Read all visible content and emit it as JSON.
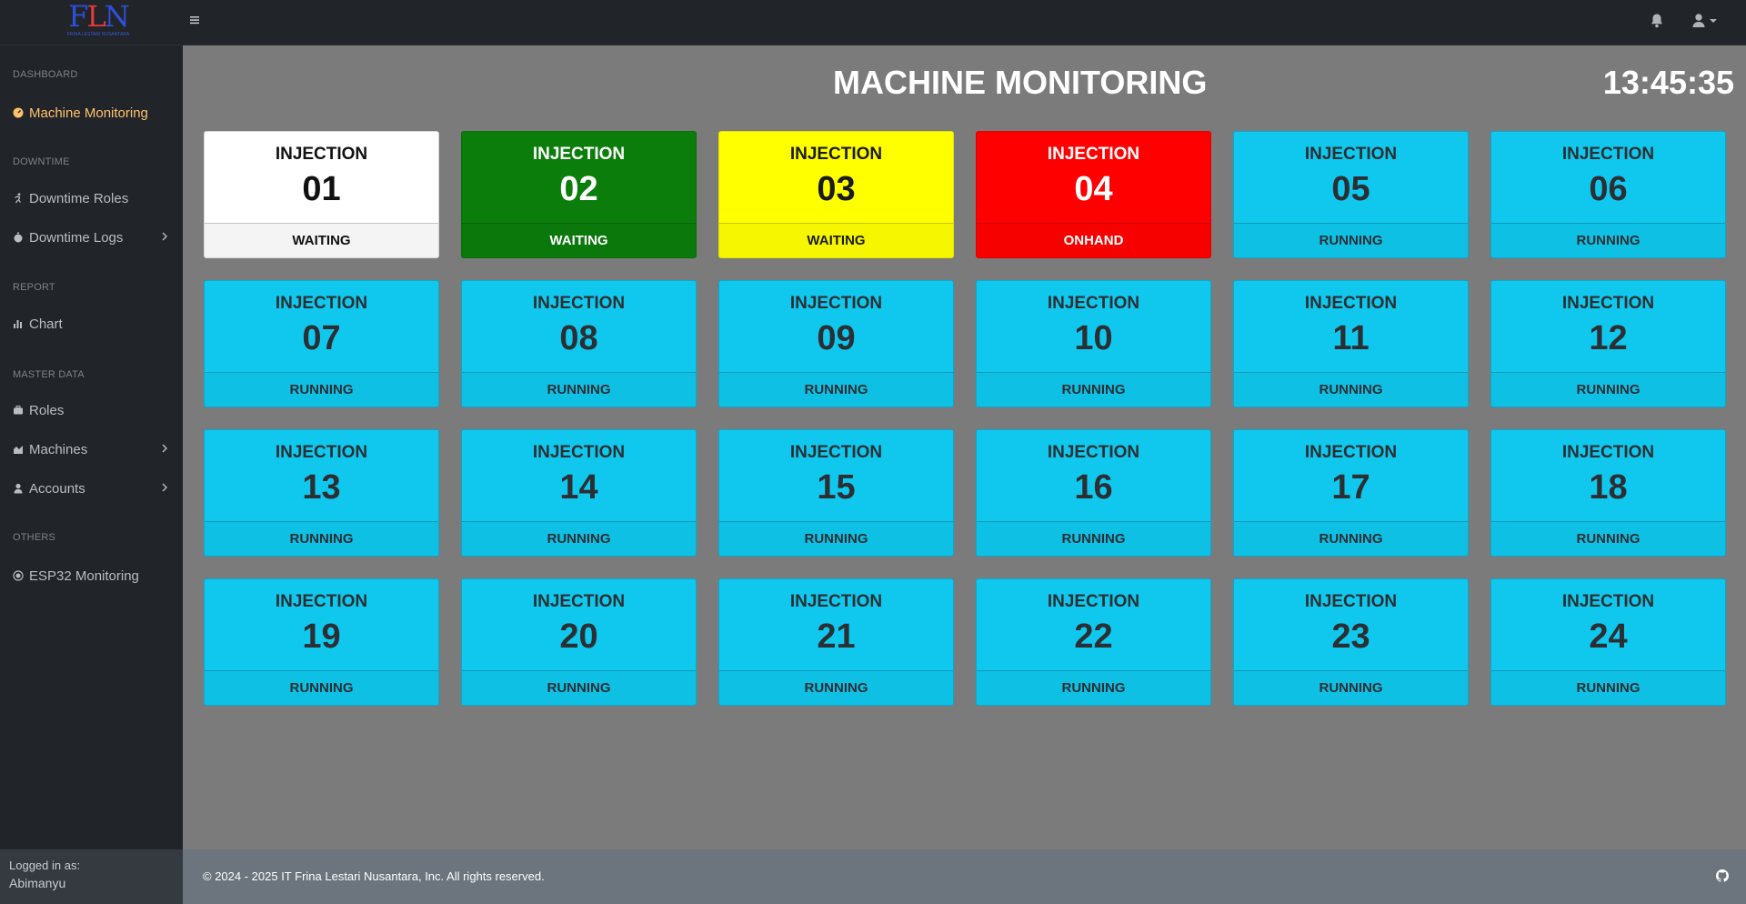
{
  "brand": {
    "logo_text_left": "F",
    "logo_text_mid": "L",
    "logo_text_right": "N",
    "logo_subtext": "FRINA LESTARI NUSANTARA"
  },
  "header": {
    "menu_icon": "hamburger-icon",
    "notification_icon": "bell-icon",
    "user_icon": "user-icon"
  },
  "sidebar": {
    "sections": [
      {
        "heading": "DASHBOARD"
      },
      {
        "heading": "DOWNTIME"
      },
      {
        "heading": "REPORT"
      },
      {
        "heading": "MASTER DATA"
      },
      {
        "heading": "OTHERS"
      }
    ],
    "items": [
      {
        "label": "Machine Monitoring",
        "icon": "gauge-icon",
        "active": true
      },
      {
        "label": "Downtime Roles",
        "icon": "running-icon"
      },
      {
        "label": "Downtime Logs",
        "icon": "stopwatch-icon",
        "has_submenu": true
      },
      {
        "label": "Chart",
        "icon": "bar-chart-icon"
      },
      {
        "label": "Roles",
        "icon": "briefcase-icon"
      },
      {
        "label": "Machines",
        "icon": "area-chart-icon",
        "has_submenu": true
      },
      {
        "label": "Accounts",
        "icon": "user-icon",
        "has_submenu": true
      },
      {
        "label": "ESP32 Monitoring",
        "icon": "chip-icon"
      }
    ],
    "footer": {
      "logged_in_label": "Logged in as:",
      "username": "Abimanyu"
    },
    "active_color": "#ffc16c"
  },
  "main": {
    "title": "MACHINE MONITORING",
    "clock": "13:45:35",
    "machines": [
      {
        "label": "INJECTION",
        "number": "01",
        "status": "WAITING",
        "color": "white"
      },
      {
        "label": "INJECTION",
        "number": "02",
        "status": "WAITING",
        "color": "green"
      },
      {
        "label": "INJECTION",
        "number": "03",
        "status": "WAITING",
        "color": "yellow"
      },
      {
        "label": "INJECTION",
        "number": "04",
        "status": "ONHAND",
        "color": "red"
      },
      {
        "label": "INJECTION",
        "number": "05",
        "status": "RUNNING",
        "color": "cyan"
      },
      {
        "label": "INJECTION",
        "number": "06",
        "status": "RUNNING",
        "color": "cyan"
      },
      {
        "label": "INJECTION",
        "number": "07",
        "status": "RUNNING",
        "color": "cyan"
      },
      {
        "label": "INJECTION",
        "number": "08",
        "status": "RUNNING",
        "color": "cyan"
      },
      {
        "label": "INJECTION",
        "number": "09",
        "status": "RUNNING",
        "color": "cyan"
      },
      {
        "label": "INJECTION",
        "number": "10",
        "status": "RUNNING",
        "color": "cyan"
      },
      {
        "label": "INJECTION",
        "number": "11",
        "status": "RUNNING",
        "color": "cyan"
      },
      {
        "label": "INJECTION",
        "number": "12",
        "status": "RUNNING",
        "color": "cyan"
      },
      {
        "label": "INJECTION",
        "number": "13",
        "status": "RUNNING",
        "color": "cyan"
      },
      {
        "label": "INJECTION",
        "number": "14",
        "status": "RUNNING",
        "color": "cyan"
      },
      {
        "label": "INJECTION",
        "number": "15",
        "status": "RUNNING",
        "color": "cyan"
      },
      {
        "label": "INJECTION",
        "number": "16",
        "status": "RUNNING",
        "color": "cyan"
      },
      {
        "label": "INJECTION",
        "number": "17",
        "status": "RUNNING",
        "color": "cyan"
      },
      {
        "label": "INJECTION",
        "number": "18",
        "status": "RUNNING",
        "color": "cyan"
      },
      {
        "label": "INJECTION",
        "number": "19",
        "status": "RUNNING",
        "color": "cyan"
      },
      {
        "label": "INJECTION",
        "number": "20",
        "status": "RUNNING",
        "color": "cyan"
      },
      {
        "label": "INJECTION",
        "number": "21",
        "status": "RUNNING",
        "color": "cyan"
      },
      {
        "label": "INJECTION",
        "number": "22",
        "status": "RUNNING",
        "color": "cyan"
      },
      {
        "label": "INJECTION",
        "number": "23",
        "status": "RUNNING",
        "color": "cyan"
      },
      {
        "label": "INJECTION",
        "number": "24",
        "status": "RUNNING",
        "color": "cyan"
      }
    ],
    "status_colors": {
      "white": "#ffffff",
      "green": "#0b7d0b",
      "yellow": "#ffff00",
      "red": "#ff0000",
      "cyan": "#10c8ee"
    }
  },
  "footer": {
    "copyright": "© 2024 - 2025  IT Frina Lestari Nusantara, Inc. All rights reserved.",
    "github_icon": "github-icon"
  }
}
